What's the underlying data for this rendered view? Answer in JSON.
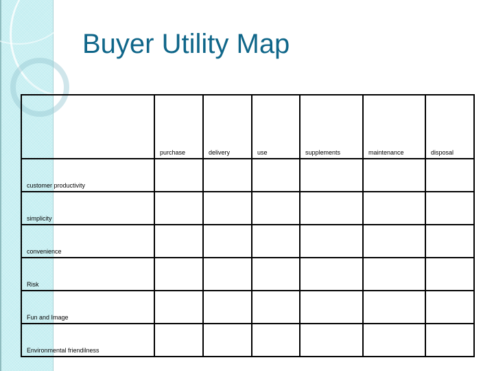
{
  "slide": {
    "title": "Buyer Utility Map",
    "theme_colors": {
      "title": "#0f6689",
      "side_band": "#c4eef1",
      "grid_lines": "#000000"
    }
  },
  "table": {
    "corner_label": "",
    "columns": [
      "purchase",
      "delivery",
      "use",
      "supplements",
      "maintenance",
      "disposal"
    ],
    "rows": [
      {
        "label": "customer productivity",
        "cells": [
          "",
          "",
          "",
          "",
          "",
          ""
        ]
      },
      {
        "label": "simplicity",
        "cells": [
          "",
          "",
          "",
          "",
          "",
          ""
        ]
      },
      {
        "label": "convenience",
        "cells": [
          "",
          "",
          "",
          "",
          "",
          ""
        ]
      },
      {
        "label": "Risk",
        "cells": [
          "",
          "",
          "",
          "",
          "",
          ""
        ]
      },
      {
        "label": "Fun and Image",
        "cells": [
          "",
          "",
          "",
          "",
          "",
          ""
        ]
      },
      {
        "label": "Environmental friendilness",
        "cells": [
          "",
          "",
          "",
          "",
          "",
          ""
        ]
      }
    ]
  }
}
